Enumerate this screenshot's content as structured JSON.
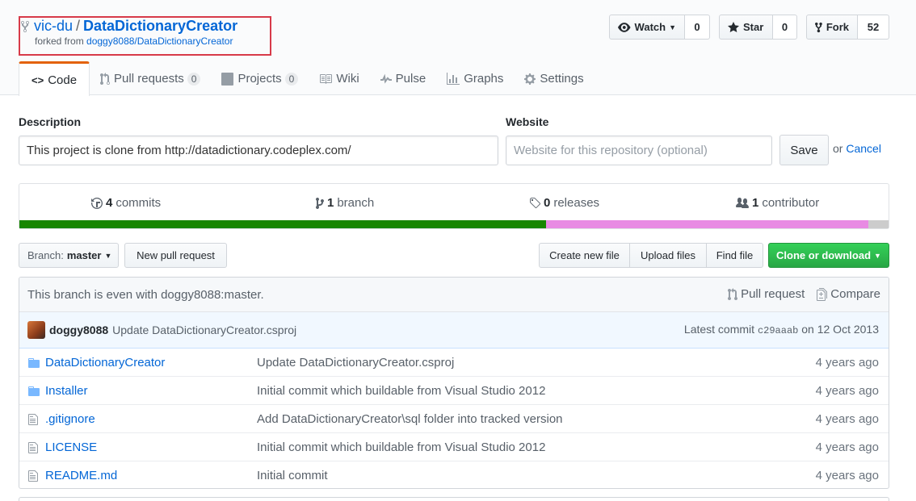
{
  "repo": {
    "owner": "vic-du",
    "separator": "/",
    "name": "DataDictionaryCreator",
    "forked_prefix": "forked from",
    "forked_source": "doggy8088/DataDictionaryCreator"
  },
  "actions": {
    "watch_label": "Watch",
    "watch_count": "0",
    "star_label": "Star",
    "star_count": "0",
    "fork_label": "Fork",
    "fork_count": "52"
  },
  "tabs": [
    {
      "label": "Code",
      "icon": "code-icon",
      "selected": true
    },
    {
      "label": "Pull requests",
      "counter": "0",
      "icon": "git-pull-request-icon"
    },
    {
      "label": "Projects",
      "counter": "0",
      "icon": "project-icon"
    },
    {
      "label": "Wiki",
      "icon": "book-icon"
    },
    {
      "label": "Pulse",
      "icon": "pulse-icon"
    },
    {
      "label": "Graphs",
      "icon": "graph-icon"
    },
    {
      "label": "Settings",
      "icon": "gear-icon"
    }
  ],
  "edit": {
    "description_label": "Description",
    "description_value": "This project is clone from http://datadictionary.codeplex.com/",
    "website_label": "Website",
    "website_placeholder": "Website for this repository (optional)",
    "save_label": "Save",
    "or_text": "or",
    "cancel_label": "Cancel"
  },
  "summary": {
    "commits_count": "4",
    "commits_label": "commits",
    "branch_count": "1",
    "branch_label": "branch",
    "releases_count": "0",
    "releases_label": "releases",
    "contributor_count": "1",
    "contributor_label": "contributor",
    "languages": [
      {
        "color": "#178600",
        "percent": 60.6
      },
      {
        "color": "#e88be3",
        "percent": 37.1
      },
      {
        "color": "#cccccc",
        "percent": 2.3
      }
    ]
  },
  "toolbar": {
    "branch_prefix": "Branch:",
    "branch_name": "master",
    "new_pr_label": "New pull request",
    "create_file_label": "Create new file",
    "upload_files_label": "Upload files",
    "find_file_label": "Find file",
    "clone_label": "Clone or download"
  },
  "branch_info": {
    "text": "This branch is even with doggy8088:master.",
    "pull_request_label": "Pull request",
    "compare_label": "Compare"
  },
  "last_commit": {
    "author": "doggy8088",
    "message": "Update DataDictionaryCreator.csproj",
    "latest_label": "Latest commit",
    "sha": "c29aaab",
    "date": "on 12 Oct 2013"
  },
  "files": [
    {
      "name": "DataDictionaryCreator",
      "type": "dir",
      "message": "Update DataDictionaryCreator.csproj",
      "age": "4 years ago"
    },
    {
      "name": "Installer",
      "type": "dir",
      "message": "Initial commit which buildable from Visual Studio 2012",
      "age": "4 years ago"
    },
    {
      "name": ".gitignore",
      "type": "file",
      "message": "Add DataDictionaryCreator\\sql folder into tracked version",
      "age": "4 years ago"
    },
    {
      "name": "LICENSE",
      "type": "file",
      "message": "Initial commit which buildable from Visual Studio 2012",
      "age": "4 years ago"
    },
    {
      "name": "README.md",
      "type": "file",
      "message": "Initial commit",
      "age": "4 years ago"
    }
  ],
  "colors": {
    "accent": "#0366d6",
    "clone_button": "#28a745",
    "highlight_box": "#d73a49",
    "tab_selected": "#e36209"
  }
}
